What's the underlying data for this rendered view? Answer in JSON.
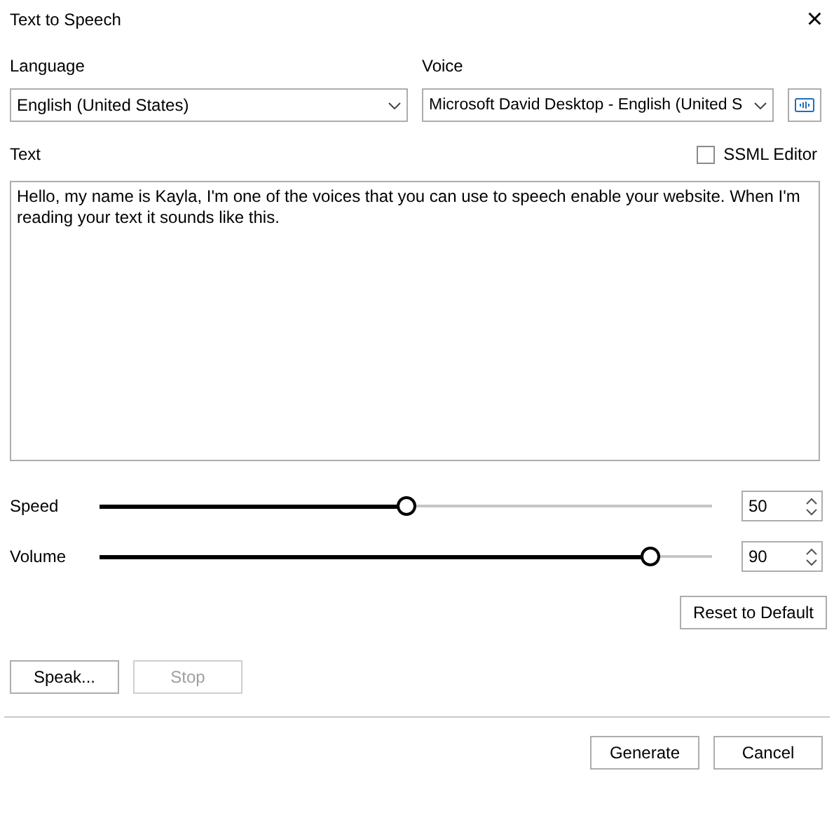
{
  "window": {
    "title": "Text to Speech",
    "close": "×"
  },
  "language": {
    "label": "Language",
    "value": "English (United States)"
  },
  "voice": {
    "label": "Voice",
    "value": "Microsoft David Desktop - English (United S"
  },
  "text": {
    "label": "Text",
    "value": "Hello, my name is Kayla, I'm one of the voices that you can use to speech enable your website. When I'm reading your text it sounds like this."
  },
  "ssml_editor": {
    "label": "SSML Editor",
    "checked": false
  },
  "sliders": [
    {
      "label": "Speed",
      "level": 0.5,
      "value": "50"
    },
    {
      "label": "Volume",
      "level": 0.9,
      "value": "90"
    }
  ],
  "reset_button": {
    "label": "Reset to Default"
  },
  "playback_buttons": [
    {
      "label": "Speak...",
      "disabled": false
    },
    {
      "label": "Stop",
      "disabled": true
    }
  ],
  "footer_buttons": [
    {
      "label": "Generate"
    },
    {
      "label": "Cancel"
    }
  ]
}
